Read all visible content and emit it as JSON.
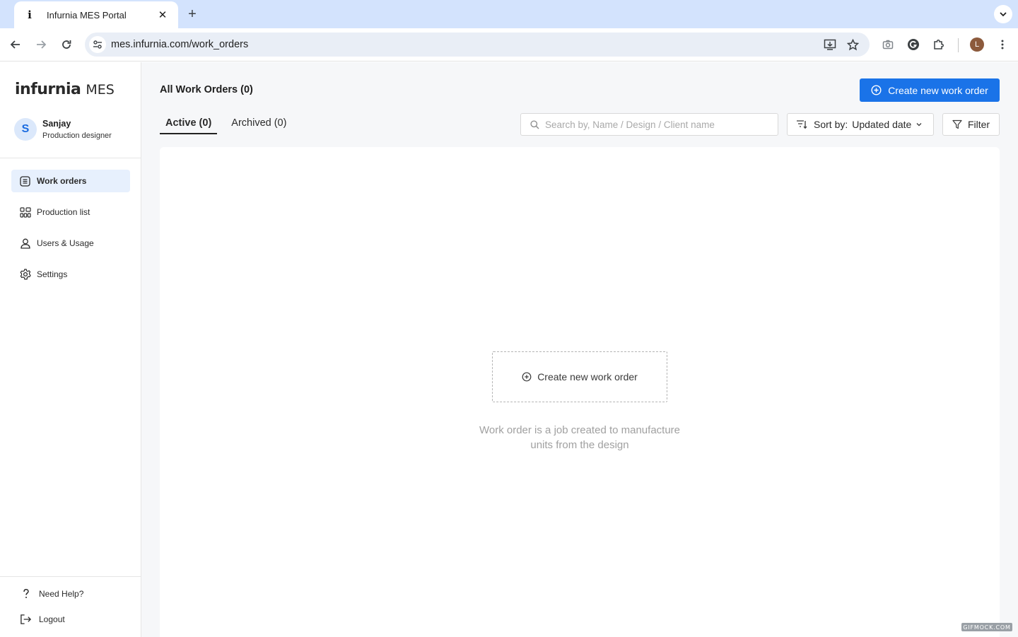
{
  "browser": {
    "tab_favicon": "i",
    "tab_title": "Infurnia MES Portal",
    "url": "mes.infurnia.com/work_orders",
    "profile_initial": "L"
  },
  "sidebar": {
    "logo_brand": "infurnia",
    "logo_suffix": "MES",
    "user": {
      "initial": "S",
      "name": "Sanjay",
      "role": "Production designer"
    },
    "items": [
      {
        "label": "Work orders",
        "icon": "list-icon",
        "active": true
      },
      {
        "label": "Production list",
        "icon": "grid-icon",
        "active": false
      },
      {
        "label": "Users & Usage",
        "icon": "user-icon",
        "active": false
      },
      {
        "label": "Settings",
        "icon": "gear-icon",
        "active": false
      }
    ],
    "footer": [
      {
        "label": "Need Help?",
        "icon": "question-icon"
      },
      {
        "label": "Logout",
        "icon": "logout-icon"
      }
    ]
  },
  "main": {
    "title": "All Work Orders (0)",
    "create_button": "Create new work order",
    "tabs": [
      {
        "label": "Active (0)",
        "active": true
      },
      {
        "label": "Archived (0)",
        "active": false
      }
    ],
    "search_placeholder": "Search by, Name / Design / Client name",
    "sort_prefix": "Sort by:",
    "sort_value": "Updated date",
    "filter_label": "Filter",
    "empty": {
      "button": "Create new work order",
      "description": "Work order is a job created to manufacture units from the design"
    }
  },
  "colors": {
    "accent": "#1a73e8",
    "active_nav_bg": "#e7f0fd",
    "page_bg": "#f6f7f9"
  },
  "watermark": "GIFMOCK.COM"
}
